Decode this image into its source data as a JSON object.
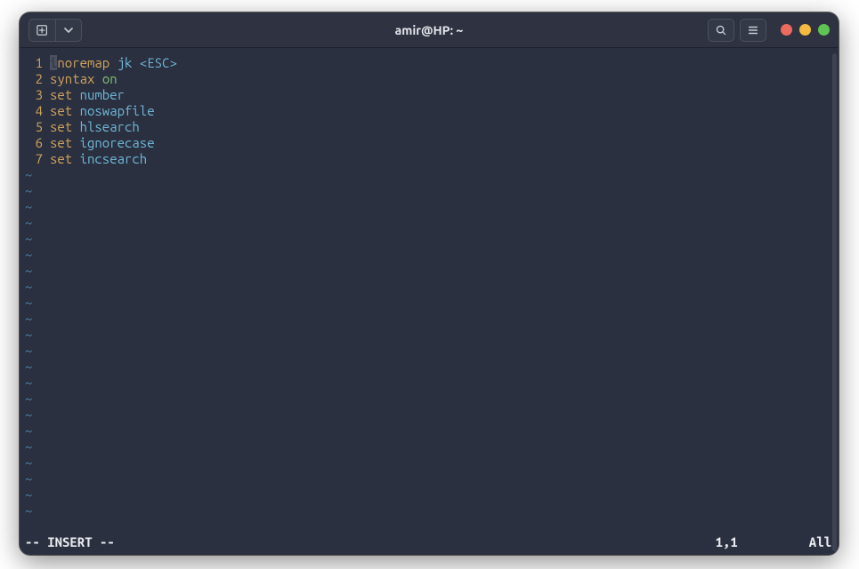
{
  "titlebar": {
    "title": "amir@HP: ~",
    "icons": {
      "new_tab": "new-tab-icon",
      "new_tab_dropdown": "dropdown-icon",
      "search": "search-icon",
      "hamburger": "hamburger-icon"
    }
  },
  "editor": {
    "lines": [
      {
        "num": "1",
        "tokens": [
          {
            "t": "cursor",
            "v": "i"
          },
          {
            "t": "kw",
            "v": "noremap"
          },
          {
            "t": "plain",
            "v": " "
          },
          {
            "t": "opt",
            "v": "jk"
          },
          {
            "t": "plain",
            "v": " "
          },
          {
            "t": "brkt",
            "v": "<ESC>"
          }
        ]
      },
      {
        "num": "2",
        "tokens": [
          {
            "t": "kw",
            "v": "syntax"
          },
          {
            "t": "plain",
            "v": " "
          },
          {
            "t": "val",
            "v": "on"
          }
        ]
      },
      {
        "num": "3",
        "tokens": [
          {
            "t": "kw",
            "v": "set"
          },
          {
            "t": "plain",
            "v": " "
          },
          {
            "t": "opt",
            "v": "number"
          }
        ]
      },
      {
        "num": "4",
        "tokens": [
          {
            "t": "kw",
            "v": "set"
          },
          {
            "t": "plain",
            "v": " "
          },
          {
            "t": "opt",
            "v": "noswapfile"
          }
        ]
      },
      {
        "num": "5",
        "tokens": [
          {
            "t": "kw",
            "v": "set"
          },
          {
            "t": "plain",
            "v": " "
          },
          {
            "t": "opt",
            "v": "hlsearch"
          }
        ]
      },
      {
        "num": "6",
        "tokens": [
          {
            "t": "kw",
            "v": "set"
          },
          {
            "t": "plain",
            "v": " "
          },
          {
            "t": "opt",
            "v": "ignorecase"
          }
        ]
      },
      {
        "num": "7",
        "tokens": [
          {
            "t": "kw",
            "v": "set"
          },
          {
            "t": "plain",
            "v": " "
          },
          {
            "t": "opt",
            "v": "incsearch"
          }
        ]
      }
    ],
    "tilde_rows": 22,
    "tilde_char": "~"
  },
  "status": {
    "mode": "-- INSERT --",
    "position": "1,1",
    "scope": "All"
  }
}
